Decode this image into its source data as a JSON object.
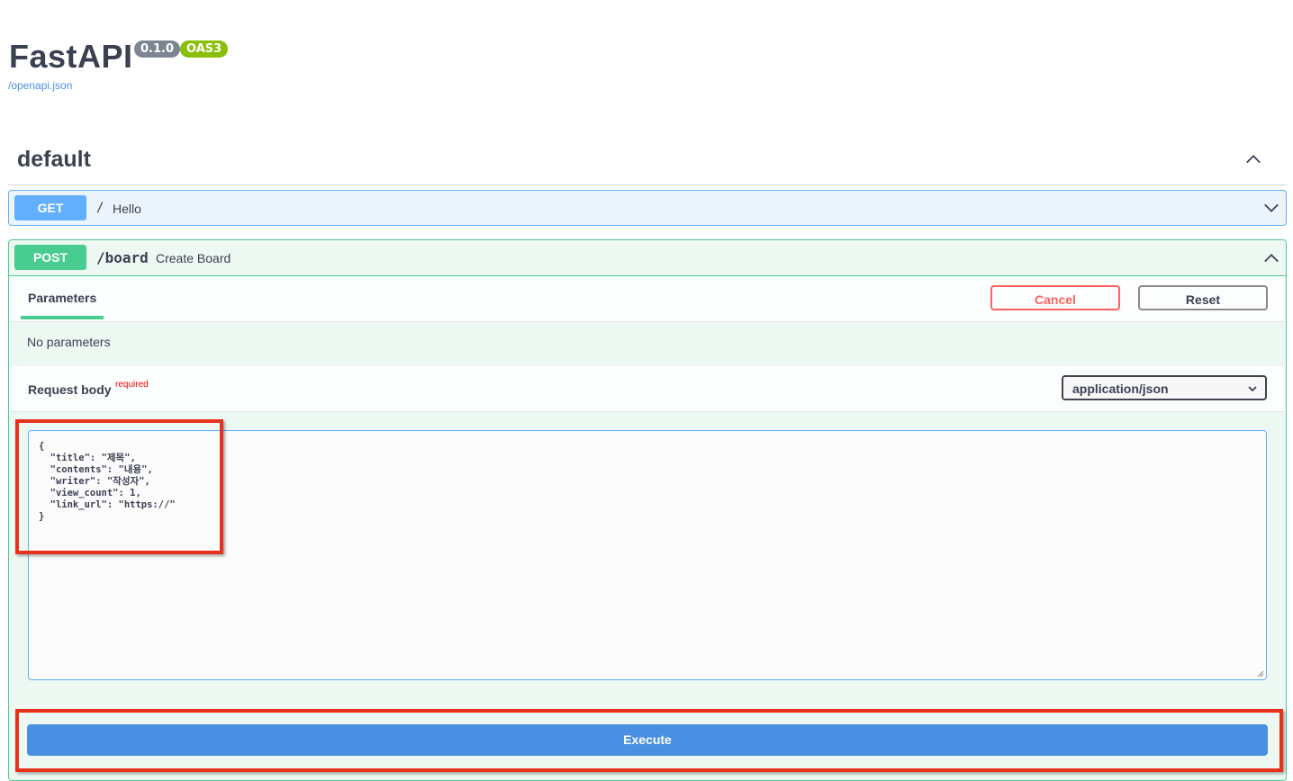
{
  "header": {
    "title": "FastAPI",
    "version_badge": "0.1.0",
    "oas_badge": "OAS3",
    "spec_link": "/openapi.json"
  },
  "section": {
    "title": "default",
    "collapse_icon": "chevron-up-icon"
  },
  "operations": [
    {
      "method": "GET",
      "path": "/",
      "summary": "Hello",
      "color": "#61affe",
      "expand_icon": "chevron-down-icon"
    },
    {
      "method": "POST",
      "path": "/board",
      "summary": "Create Board",
      "color": "#49cc90",
      "collapse_icon": "chevron-up-icon",
      "parameters_tab": "Parameters",
      "cancel_label": "Cancel",
      "reset_label": "Reset",
      "no_parameters": "No parameters",
      "request_body_label": "Request body",
      "required_label": "required",
      "content_type": "application/json",
      "request_body": "{\n  \"title\": \"제목\",\n  \"contents\": \"내용\",\n  \"writer\": \"작성자\",\n  \"view_count\": 1,\n  \"link_url\": \"https://\"\n}",
      "execute_label": "Execute"
    }
  ],
  "colors": {
    "get": "#61affe",
    "post": "#49cc90",
    "cancel": "#ff6060",
    "execute": "#4990e2",
    "annotation_highlight": "#e8311a"
  }
}
